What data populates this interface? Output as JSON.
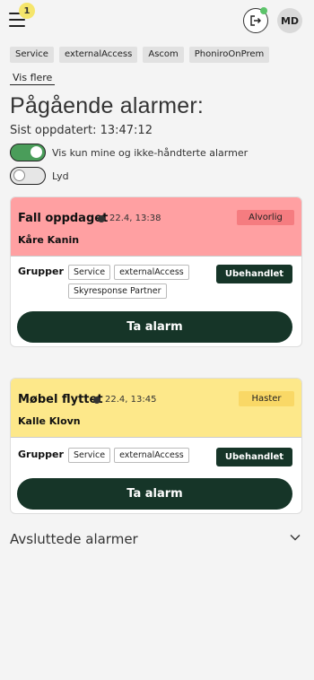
{
  "header": {
    "menu_badge": "1",
    "avatar_initials": "MD",
    "online_color": "#5cc46a"
  },
  "filters": [
    "Service",
    "externalAccess",
    "Ascom",
    "PhoniroOnPrem"
  ],
  "show_more": "Vis flere",
  "page_title": "Pågående alarmer:",
  "last_updated": "Sist oppdatert: 13:47:12",
  "toggles": {
    "mine_only": {
      "label": "Vis kun mine og ikke-håndterte alarmer",
      "on": true
    },
    "sound": {
      "label": "Lyd",
      "on": false
    }
  },
  "alarms": [
    {
      "title": "Fall oppdaget",
      "time": "22.4, 13:38",
      "person": "Kåre Kanin",
      "priority": "Alvorlig",
      "color": "#ffa0a2",
      "groups_label": "Grupper",
      "groups": [
        "Service",
        "externalAccess",
        "Skyresponse Partner"
      ],
      "status": "Ubehandlet",
      "action": "Ta alarm"
    },
    {
      "title": "Møbel flyttet",
      "time": "22.4, 13:45",
      "person": "Kalle Klovn",
      "priority": "Haster",
      "color": "#fde88a",
      "groups_label": "Grupper",
      "groups": [
        "Service",
        "externalAccess"
      ],
      "status": "Ubehandlet",
      "action": "Ta alarm"
    }
  ],
  "closed_section": {
    "title": "Avsluttede alarmer"
  }
}
